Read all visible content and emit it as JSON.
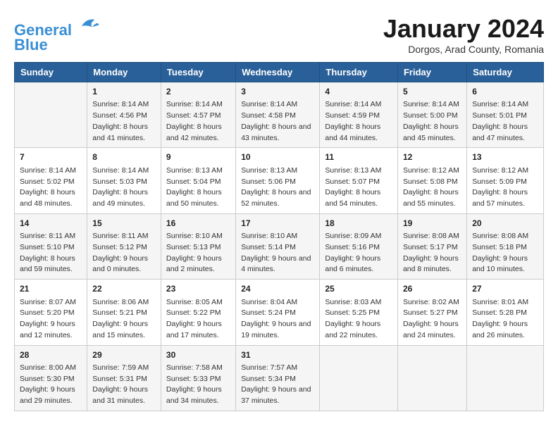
{
  "header": {
    "logo_line1": "General",
    "logo_line2": "Blue",
    "month_title": "January 2024",
    "location": "Dorgos, Arad County, Romania"
  },
  "days_of_week": [
    "Sunday",
    "Monday",
    "Tuesday",
    "Wednesday",
    "Thursday",
    "Friday",
    "Saturday"
  ],
  "weeks": [
    [
      {
        "day": "",
        "sunrise": "",
        "sunset": "",
        "daylight": ""
      },
      {
        "day": "1",
        "sunrise": "Sunrise: 8:14 AM",
        "sunset": "Sunset: 4:56 PM",
        "daylight": "Daylight: 8 hours and 41 minutes."
      },
      {
        "day": "2",
        "sunrise": "Sunrise: 8:14 AM",
        "sunset": "Sunset: 4:57 PM",
        "daylight": "Daylight: 8 hours and 42 minutes."
      },
      {
        "day": "3",
        "sunrise": "Sunrise: 8:14 AM",
        "sunset": "Sunset: 4:58 PM",
        "daylight": "Daylight: 8 hours and 43 minutes."
      },
      {
        "day": "4",
        "sunrise": "Sunrise: 8:14 AM",
        "sunset": "Sunset: 4:59 PM",
        "daylight": "Daylight: 8 hours and 44 minutes."
      },
      {
        "day": "5",
        "sunrise": "Sunrise: 8:14 AM",
        "sunset": "Sunset: 5:00 PM",
        "daylight": "Daylight: 8 hours and 45 minutes."
      },
      {
        "day": "6",
        "sunrise": "Sunrise: 8:14 AM",
        "sunset": "Sunset: 5:01 PM",
        "daylight": "Daylight: 8 hours and 47 minutes."
      }
    ],
    [
      {
        "day": "7",
        "sunrise": "Sunrise: 8:14 AM",
        "sunset": "Sunset: 5:02 PM",
        "daylight": "Daylight: 8 hours and 48 minutes."
      },
      {
        "day": "8",
        "sunrise": "Sunrise: 8:14 AM",
        "sunset": "Sunset: 5:03 PM",
        "daylight": "Daylight: 8 hours and 49 minutes."
      },
      {
        "day": "9",
        "sunrise": "Sunrise: 8:13 AM",
        "sunset": "Sunset: 5:04 PM",
        "daylight": "Daylight: 8 hours and 50 minutes."
      },
      {
        "day": "10",
        "sunrise": "Sunrise: 8:13 AM",
        "sunset": "Sunset: 5:06 PM",
        "daylight": "Daylight: 8 hours and 52 minutes."
      },
      {
        "day": "11",
        "sunrise": "Sunrise: 8:13 AM",
        "sunset": "Sunset: 5:07 PM",
        "daylight": "Daylight: 8 hours and 54 minutes."
      },
      {
        "day": "12",
        "sunrise": "Sunrise: 8:12 AM",
        "sunset": "Sunset: 5:08 PM",
        "daylight": "Daylight: 8 hours and 55 minutes."
      },
      {
        "day": "13",
        "sunrise": "Sunrise: 8:12 AM",
        "sunset": "Sunset: 5:09 PM",
        "daylight": "Daylight: 8 hours and 57 minutes."
      }
    ],
    [
      {
        "day": "14",
        "sunrise": "Sunrise: 8:11 AM",
        "sunset": "Sunset: 5:10 PM",
        "daylight": "Daylight: 8 hours and 59 minutes."
      },
      {
        "day": "15",
        "sunrise": "Sunrise: 8:11 AM",
        "sunset": "Sunset: 5:12 PM",
        "daylight": "Daylight: 9 hours and 0 minutes."
      },
      {
        "day": "16",
        "sunrise": "Sunrise: 8:10 AM",
        "sunset": "Sunset: 5:13 PM",
        "daylight": "Daylight: 9 hours and 2 minutes."
      },
      {
        "day": "17",
        "sunrise": "Sunrise: 8:10 AM",
        "sunset": "Sunset: 5:14 PM",
        "daylight": "Daylight: 9 hours and 4 minutes."
      },
      {
        "day": "18",
        "sunrise": "Sunrise: 8:09 AM",
        "sunset": "Sunset: 5:16 PM",
        "daylight": "Daylight: 9 hours and 6 minutes."
      },
      {
        "day": "19",
        "sunrise": "Sunrise: 8:08 AM",
        "sunset": "Sunset: 5:17 PM",
        "daylight": "Daylight: 9 hours and 8 minutes."
      },
      {
        "day": "20",
        "sunrise": "Sunrise: 8:08 AM",
        "sunset": "Sunset: 5:18 PM",
        "daylight": "Daylight: 9 hours and 10 minutes."
      }
    ],
    [
      {
        "day": "21",
        "sunrise": "Sunrise: 8:07 AM",
        "sunset": "Sunset: 5:20 PM",
        "daylight": "Daylight: 9 hours and 12 minutes."
      },
      {
        "day": "22",
        "sunrise": "Sunrise: 8:06 AM",
        "sunset": "Sunset: 5:21 PM",
        "daylight": "Daylight: 9 hours and 15 minutes."
      },
      {
        "day": "23",
        "sunrise": "Sunrise: 8:05 AM",
        "sunset": "Sunset: 5:22 PM",
        "daylight": "Daylight: 9 hours and 17 minutes."
      },
      {
        "day": "24",
        "sunrise": "Sunrise: 8:04 AM",
        "sunset": "Sunset: 5:24 PM",
        "daylight": "Daylight: 9 hours and 19 minutes."
      },
      {
        "day": "25",
        "sunrise": "Sunrise: 8:03 AM",
        "sunset": "Sunset: 5:25 PM",
        "daylight": "Daylight: 9 hours and 22 minutes."
      },
      {
        "day": "26",
        "sunrise": "Sunrise: 8:02 AM",
        "sunset": "Sunset: 5:27 PM",
        "daylight": "Daylight: 9 hours and 24 minutes."
      },
      {
        "day": "27",
        "sunrise": "Sunrise: 8:01 AM",
        "sunset": "Sunset: 5:28 PM",
        "daylight": "Daylight: 9 hours and 26 minutes."
      }
    ],
    [
      {
        "day": "28",
        "sunrise": "Sunrise: 8:00 AM",
        "sunset": "Sunset: 5:30 PM",
        "daylight": "Daylight: 9 hours and 29 minutes."
      },
      {
        "day": "29",
        "sunrise": "Sunrise: 7:59 AM",
        "sunset": "Sunset: 5:31 PM",
        "daylight": "Daylight: 9 hours and 31 minutes."
      },
      {
        "day": "30",
        "sunrise": "Sunrise: 7:58 AM",
        "sunset": "Sunset: 5:33 PM",
        "daylight": "Daylight: 9 hours and 34 minutes."
      },
      {
        "day": "31",
        "sunrise": "Sunrise: 7:57 AM",
        "sunset": "Sunset: 5:34 PM",
        "daylight": "Daylight: 9 hours and 37 minutes."
      },
      {
        "day": "",
        "sunrise": "",
        "sunset": "",
        "daylight": ""
      },
      {
        "day": "",
        "sunrise": "",
        "sunset": "",
        "daylight": ""
      },
      {
        "day": "",
        "sunrise": "",
        "sunset": "",
        "daylight": ""
      }
    ]
  ],
  "accent_color": "#2a6099"
}
